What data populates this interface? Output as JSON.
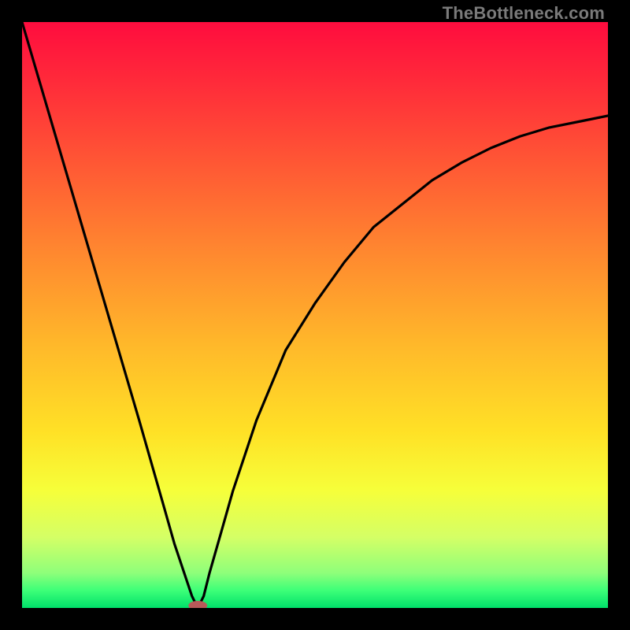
{
  "watermark": "TheBottleneck.com",
  "chart_data": {
    "type": "line",
    "title": "",
    "xlabel": "",
    "ylabel": "",
    "xlim": [
      0,
      100
    ],
    "ylim": [
      0,
      100
    ],
    "grid": false,
    "series": [
      {
        "name": "bottleneck-curve",
        "x": [
          0,
          5,
          10,
          15,
          20,
          24,
          26,
          28,
          29,
          30,
          31,
          32,
          34,
          36,
          38,
          40,
          45,
          50,
          55,
          60,
          65,
          70,
          75,
          80,
          85,
          90,
          95,
          100
        ],
        "y": [
          100,
          83,
          66,
          49,
          32,
          18,
          11,
          5,
          2,
          0,
          2,
          6,
          13,
          20,
          26,
          32,
          44,
          52,
          59,
          65,
          69,
          73,
          76,
          78.5,
          80.5,
          82,
          83,
          84
        ]
      }
    ],
    "marker": {
      "x": 30,
      "y": 0,
      "color": "#b85a5a",
      "rx": 12,
      "ry": 6
    },
    "gradient_stops": [
      {
        "offset": 0.0,
        "color": "#ff0c3e"
      },
      {
        "offset": 0.1,
        "color": "#ff2a3a"
      },
      {
        "offset": 0.25,
        "color": "#ff5a34"
      },
      {
        "offset": 0.4,
        "color": "#ff8a2f"
      },
      {
        "offset": 0.55,
        "color": "#ffb82a"
      },
      {
        "offset": 0.7,
        "color": "#ffe126"
      },
      {
        "offset": 0.8,
        "color": "#f6ff3a"
      },
      {
        "offset": 0.88,
        "color": "#d4ff66"
      },
      {
        "offset": 0.94,
        "color": "#8fff7a"
      },
      {
        "offset": 0.97,
        "color": "#3dff78"
      },
      {
        "offset": 1.0,
        "color": "#00e06a"
      }
    ]
  }
}
